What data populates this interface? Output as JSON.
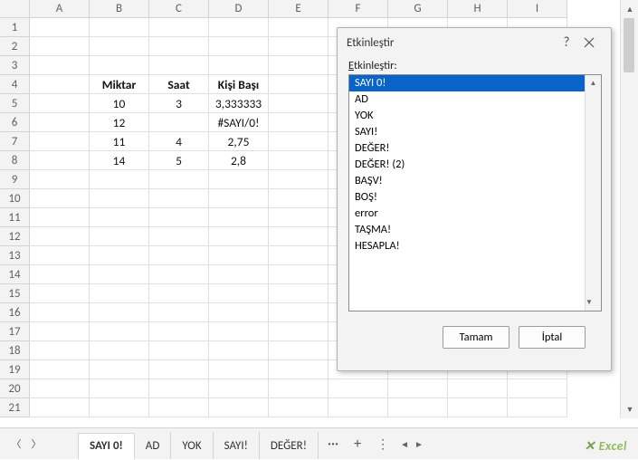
{
  "columns": [
    "A",
    "B",
    "C",
    "D",
    "E",
    "F",
    "G",
    "H",
    "I"
  ],
  "row_labels": [
    "1",
    "2",
    "3",
    "4",
    "5",
    "6",
    "7",
    "8",
    "9",
    "10",
    "11",
    "12",
    "13",
    "14",
    "15",
    "16",
    "17",
    "18",
    "19",
    "20",
    "21"
  ],
  "table": {
    "header": {
      "B": "Miktar",
      "C": "Saat",
      "D": "Kişi Başı"
    },
    "rows": [
      {
        "B": "10",
        "C": "3",
        "D": "3,333333"
      },
      {
        "B": "12",
        "C": "",
        "D": "#SAYI/0!"
      },
      {
        "B": "11",
        "C": "4",
        "D": "2,75"
      },
      {
        "B": "14",
        "C": "5",
        "D": "2,8"
      }
    ]
  },
  "dialog": {
    "title": "Etkinleştir",
    "label_prefix": "E",
    "label_rest": "tkinleştir:",
    "items": [
      "SAYI 0!",
      "AD",
      "YOK",
      "SAYI!",
      "DEĞER!",
      "DEĞER! (2)",
      "BAŞV!",
      "BOŞ!",
      "error",
      "TAŞMA!",
      "HESAPLA!"
    ],
    "selected_index": 0,
    "ok": "Tamam",
    "cancel": "İptal",
    "help": "?",
    "close": "×"
  },
  "tabs": {
    "items": [
      "SAYI 0!",
      "AD",
      "YOK",
      "SAYI!",
      "DEĞER!"
    ],
    "active_index": 0,
    "more": "···",
    "add": "+",
    "kebab": "⋮"
  },
  "watermark": "Excel"
}
